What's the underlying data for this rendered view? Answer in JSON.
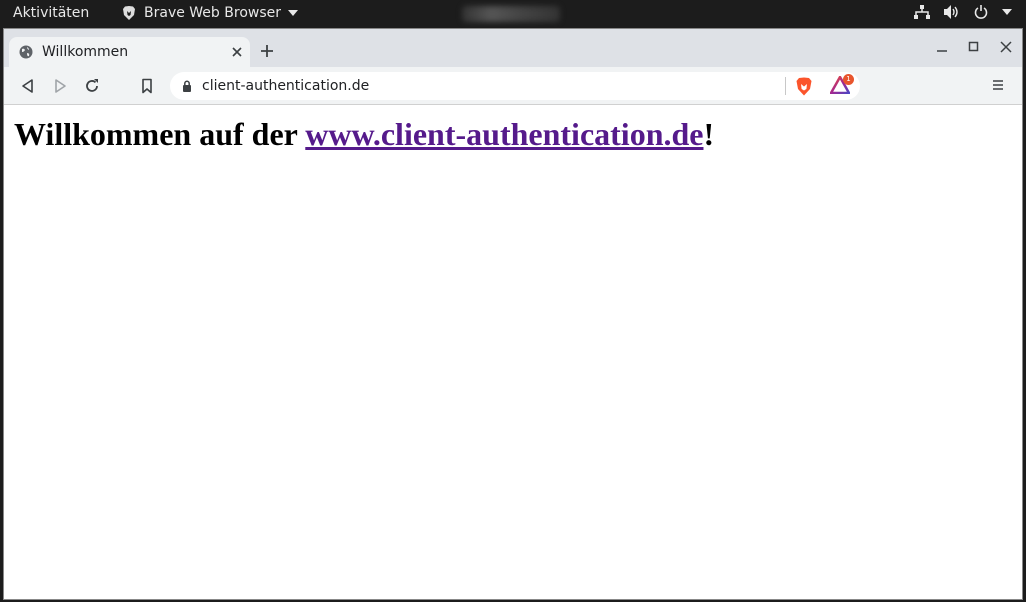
{
  "topbar": {
    "activities": "Aktivitäten",
    "app_name": "Brave Web Browser",
    "icons": [
      "network-icon",
      "volume-icon",
      "power-icon",
      "chevron-down-icon"
    ]
  },
  "browser": {
    "tab": {
      "title": "Willkommen"
    },
    "address": {
      "url": "client-authentication.de"
    },
    "rewards_badge": "1"
  },
  "page": {
    "heading_prefix": "Willkommen auf der ",
    "heading_link": "www.client-authentication.de",
    "heading_suffix": "!"
  },
  "colors": {
    "link_visited": "#551a8b",
    "brave_orange": "#fb542b",
    "tabstrip": "#dee1e6",
    "toolbar": "#f1f3f4"
  }
}
